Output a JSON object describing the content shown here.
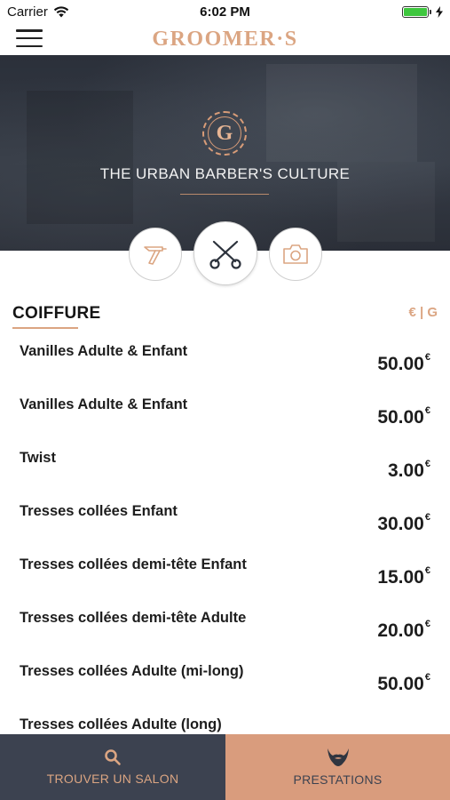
{
  "status_bar": {
    "carrier": "Carrier",
    "time": "6:02 PM",
    "battery_level": 1.0
  },
  "nav": {
    "brand": "GROOMER·S",
    "menu_icon": "hamburger-icon"
  },
  "hero": {
    "logo_letter": "G",
    "tagline": "THE URBAN BARBER'S CULTURE"
  },
  "category_buttons": [
    {
      "icon": "razor-icon",
      "selected": false
    },
    {
      "icon": "scissors-icon",
      "selected": true
    },
    {
      "icon": "camera-icon",
      "selected": false
    }
  ],
  "section": {
    "title": "COIFFURE",
    "currency_toggle": "€ | G"
  },
  "prices": [
    {
      "name": "Vanilles Adulte & Enfant",
      "price": "50.00",
      "currency": "€"
    },
    {
      "name": "Vanilles Adulte & Enfant",
      "price": "50.00",
      "currency": "€"
    },
    {
      "name": "Twist",
      "price": "3.00",
      "currency": "€"
    },
    {
      "name": "Tresses collées Enfant",
      "price": "30.00",
      "currency": "€"
    },
    {
      "name": "Tresses collées demi-tête Enfant",
      "price": "15.00",
      "currency": "€"
    },
    {
      "name": "Tresses collées demi-tête Adulte",
      "price": "20.00",
      "currency": "€"
    },
    {
      "name": "Tresses collées Adulte (mi-long)",
      "price": "50.00",
      "currency": "€"
    },
    {
      "name": "Tresses collées Adulte (long)",
      "price": "",
      "currency": ""
    }
  ],
  "tabs": [
    {
      "label": "TROUVER UN SALON",
      "icon": "search-icon",
      "active": false
    },
    {
      "label": "PRESTATIONS",
      "icon": "beard-icon",
      "active": true
    }
  ],
  "colors": {
    "accent": "#dba582",
    "dark": "#3c4250",
    "active_tab": "#d99c7d"
  }
}
